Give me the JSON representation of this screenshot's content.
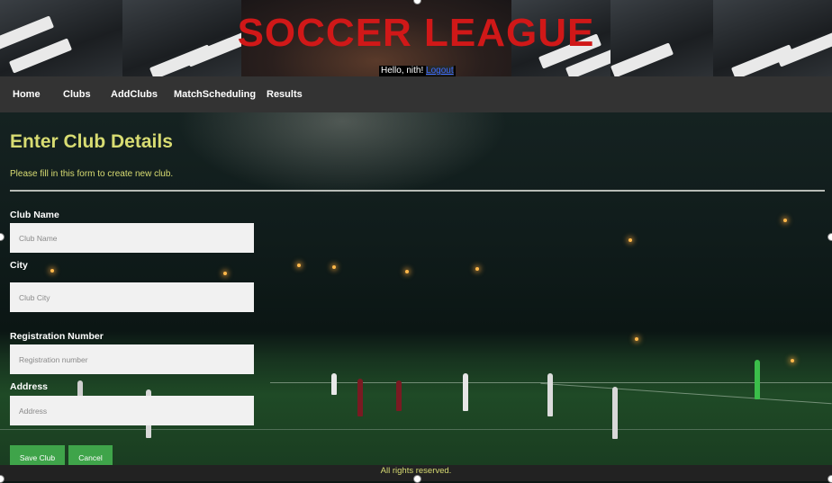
{
  "header": {
    "title": "SOCCER LEAGUE",
    "greeting": "Hello, nith!",
    "logout_label": "Logout"
  },
  "nav": {
    "items": [
      "Home",
      "Clubs",
      "AddClubs",
      "MatchScheduling",
      "Results"
    ]
  },
  "form": {
    "heading": "Enter Club Details",
    "subtitle": "Please fill in this form to create new club.",
    "club_name": {
      "label": "Club Name",
      "placeholder": "Club Name",
      "value": ""
    },
    "city": {
      "label": "City",
      "placeholder": "Club City",
      "value": ""
    },
    "registration": {
      "label": "Registration Number",
      "placeholder": "Registration number",
      "value": ""
    },
    "address": {
      "label": "Address",
      "placeholder": "Address",
      "value": ""
    },
    "save_label": "Save Club",
    "cancel_label": "Cancel"
  },
  "footer": {
    "text": "All rights reserved."
  },
  "colors": {
    "title_red": "#d01818",
    "accent_yellow": "#d8dc72",
    "nav_bg": "#333333",
    "button_green": "#3fa44a"
  }
}
